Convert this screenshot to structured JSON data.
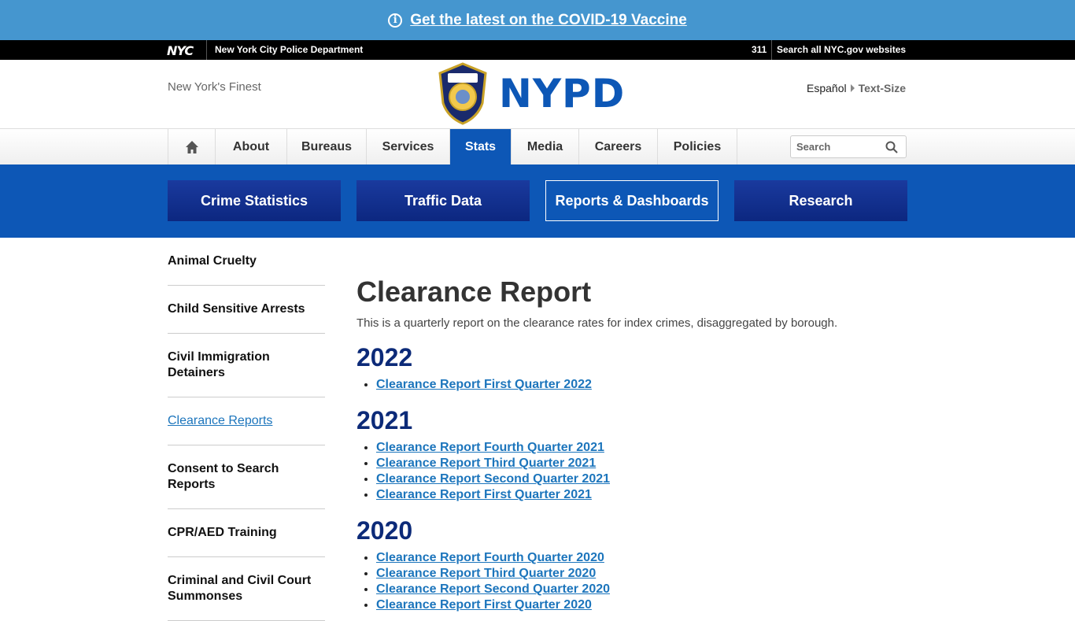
{
  "alert": {
    "text": "Get the latest on the COVID-19 Vaccine",
    "icon": "info-icon"
  },
  "nyc_bar": {
    "logo": "NYC",
    "department": "New York City Police Department",
    "phone": "311",
    "search_link": "Search all NYC.gov websites"
  },
  "header": {
    "tagline": "New York's Finest",
    "wordmark": "NYPD",
    "badge_text": "POLICE DEPARTMENT CITY OF NEW YORK",
    "language": "Español",
    "text_size": "Text-Size"
  },
  "nav": {
    "items": [
      {
        "label": "About"
      },
      {
        "label": "Bureaus"
      },
      {
        "label": "Services"
      },
      {
        "label": "Stats"
      },
      {
        "label": "Media"
      },
      {
        "label": "Careers"
      },
      {
        "label": "Policies"
      }
    ],
    "active": "Stats",
    "search_placeholder": "Search"
  },
  "subnav": {
    "buttons": [
      {
        "label": "Crime Statistics"
      },
      {
        "label": "Traffic Data"
      },
      {
        "label": "Reports & Dashboards"
      },
      {
        "label": "Research"
      }
    ],
    "active": "Reports & Dashboards"
  },
  "sidebar": {
    "items": [
      {
        "label": "Animal Cruelty"
      },
      {
        "label": "Child Sensitive Arrests"
      },
      {
        "label": "Civil Immigration Detainers"
      },
      {
        "label": "Clearance Reports"
      },
      {
        "label": "Consent to Search Reports"
      },
      {
        "label": "CPR/AED Training"
      },
      {
        "label": "Criminal and Civil Court Summonses"
      }
    ],
    "active": "Clearance Reports"
  },
  "main": {
    "title": "Clearance Report",
    "intro": "This is a quarterly report on the clearance rates for index crimes, disaggregated by borough.",
    "sections": [
      {
        "year": "2022",
        "links": [
          "Clearance Report First Quarter 2022"
        ]
      },
      {
        "year": "2021",
        "links": [
          "Clearance Report Fourth Quarter 2021",
          "Clearance Report Third Quarter 2021",
          "Clearance Report Second Quarter 2021",
          "Clearance Report First Quarter 2021"
        ]
      },
      {
        "year": "2020",
        "links": [
          "Clearance Report Fourth Quarter 2020",
          "Clearance Report Third Quarter 2020",
          "Clearance Report Second Quarter 2020",
          "Clearance Report First Quarter 2020"
        ]
      }
    ]
  },
  "colors": {
    "alert_bg": "#4596cf",
    "brand_blue": "#0d57b6",
    "navy": "#0c2780",
    "link": "#1c75bc"
  }
}
